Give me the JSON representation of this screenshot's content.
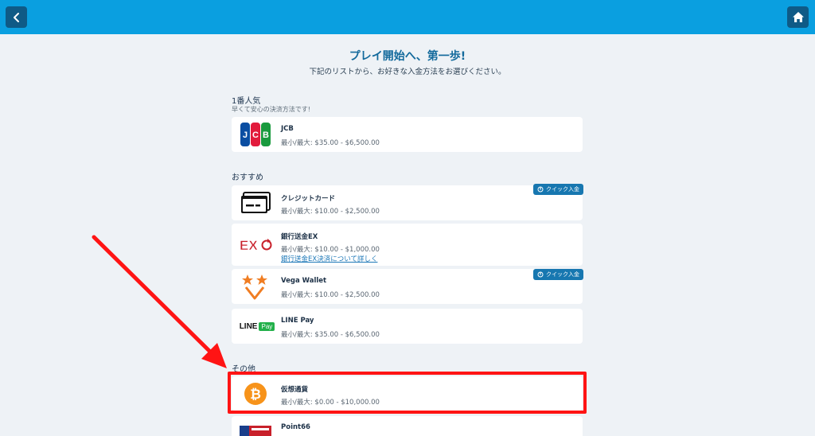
{
  "header": {
    "back_icon": "chevron-left-icon",
    "home_icon": "home-icon",
    "bar_color": "#0a9fe0"
  },
  "page": {
    "title": "プレイ開始へ、第一歩!",
    "subtitle": "下記のリストから、お好きな入金方法をお選びください。"
  },
  "sections": {
    "popular": {
      "title": "1番人気",
      "subtitle": "早くて安心の決済方法です!"
    },
    "recommended": {
      "title": "おすすめ"
    },
    "other": {
      "title": "その他"
    }
  },
  "methods": {
    "jcb": {
      "name": "JCB",
      "range": "最小/最大: $35.00 - $6,500.00",
      "logo": "jcb-logo"
    },
    "credit": {
      "name": "クレジットカード",
      "range": "最小/最大: $10.00 - $2,500.00",
      "logo": "credit-card-icon",
      "badge": "クイック入金"
    },
    "bank": {
      "name": "銀行送金EX",
      "range": "最小/最大: $10.00 - $1,000.00",
      "link": "銀行送金EX決済について詳しく",
      "logo": "bank-transfer-ex-logo"
    },
    "vega": {
      "name": "Vega Wallet",
      "range": "最小/最大: $10.00 - $2,500.00",
      "logo": "vega-wallet-logo",
      "badge": "クイック入金"
    },
    "linepay": {
      "name": "LINE Pay",
      "range": "最小/最大: $35.00 - $6,500.00",
      "logo": "line-pay-logo",
      "logo_text_a": "LINE",
      "logo_text_b": "Pay"
    },
    "crypto": {
      "name": "仮想通貨",
      "range": "最小/最大: $0.00 - $10,000.00",
      "logo": "bitcoin-icon"
    },
    "point66": {
      "name": "Point66",
      "logo": "convenience-store-logo"
    }
  },
  "annotation": {
    "color": "#ff1414"
  }
}
